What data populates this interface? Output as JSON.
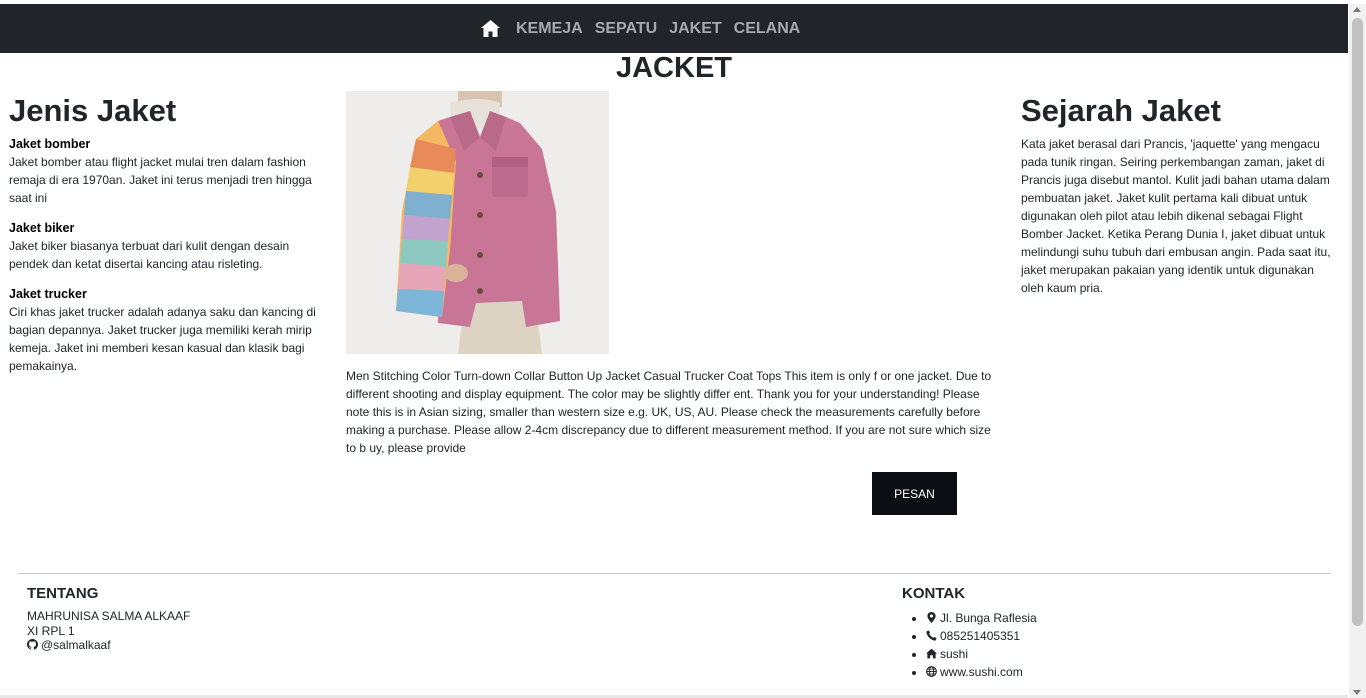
{
  "nav": {
    "items": [
      {
        "label": "KEMEJA"
      },
      {
        "label": "SEPATU"
      },
      {
        "label": "JAKET"
      },
      {
        "label": "CELANA"
      }
    ]
  },
  "page": {
    "title": "JACKET"
  },
  "left": {
    "heading": "Jenis Jaket",
    "types": [
      {
        "title": "Jaket bomber",
        "text": "Jaket bomber atau flight jacket mulai tren dalam fashion remaja di era 1970an. Jaket ini terus menjadi tren hingga saat ini"
      },
      {
        "title": "Jaket biker",
        "text": "Jaket biker biasanya terbuat dari kulit dengan desain pendek dan ketat disertai kancing atau risleting."
      },
      {
        "title": "Jaket trucker",
        "text": "Ciri khas jaket trucker adalah adanya saku dan kancing di bagian depannya. Jaket trucker juga memiliki kerah mirip kemeja. Jaket ini memberi kesan kasual dan klasik bagi pemakainya."
      }
    ]
  },
  "product": {
    "description": "Men Stitching Color Turn-down Collar Button Up Jacket Casual Trucker Coat Tops This item is only f or one jacket. Due to different shooting and display equipment. The color may be slightly differ ent. Thank you for your understanding! Please note this is in Asian sizing, smaller than western size e.g. UK, US, AU. Please check the measurements carefully before making a purchase. Please allow 2-4cm discrepancy due to different measurement method. If you are not sure which size to b uy, please provide",
    "order_label": "PESAN"
  },
  "right": {
    "heading": "Sejarah Jaket",
    "text": "Kata jaket berasal dari Prancis, 'jaquette' yang mengacu pada tunik ringan. Seiring perkembangan zaman, jaket di Prancis juga disebut mantol. Kulit jadi bahan utama dalam pembuatan jaket. Jaket kulit pertama kali dibuat untuk digunakan oleh pilot atau lebih dikenal sebagai Flight Bomber Jacket. Ketika Perang Dunia I, jaket dibuat untuk melindungi suhu tubuh dari embusan angin. Pada saat itu, jaket merupakan pakaian yang identik untuk digunakan oleh kaum pria."
  },
  "footer": {
    "about": {
      "heading": "TENTANG",
      "name": "MAHRUNISA SALMA ALKAAF",
      "class": "XI RPL 1",
      "github": "@salmalkaaf"
    },
    "contact": {
      "heading": "KONTAK",
      "address": "Jl. Bunga Raflesia",
      "phone": "085251405351",
      "home": "sushi",
      "website": "www.sushi.com"
    }
  },
  "colors": {
    "navbar": "#212529",
    "nav_link": "#a7a9ac",
    "button": "#0b0e12"
  },
  "icons": [
    "home-icon",
    "github-icon",
    "map-marker-icon",
    "phone-icon",
    "home-icon",
    "globe-icon"
  ]
}
